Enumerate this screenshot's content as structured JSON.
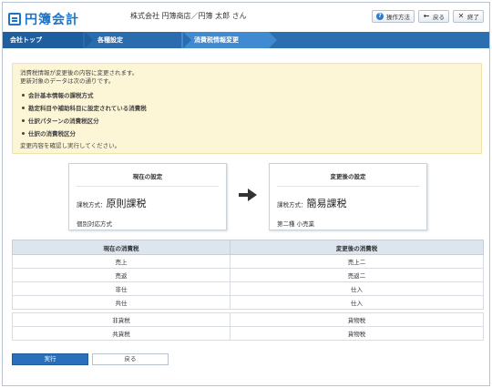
{
  "app": {
    "logo": "円簿会計",
    "company_user": "株式会社 円簿商店／円簿 太郎 さん"
  },
  "header_buttons": [
    {
      "label": "操作方法",
      "icon": "help-icon"
    },
    {
      "label": "戻る",
      "icon": "back-arrow-icon"
    },
    {
      "label": "終了",
      "icon": "close-icon"
    }
  ],
  "breadcrumb": [
    "会社トップ",
    "各種設定",
    "消費税情報変更"
  ],
  "notice": {
    "line1": "消費税情報が変更後の内容に変更されます。",
    "line2": "更新対象のデータは次の通りです。",
    "items": [
      "会計基本情報の課税方式",
      "勘定科目や補助科目に設定されている消費税",
      "仕訳パターンの消費税区分",
      "仕訳の消費税区分"
    ],
    "footer": "変更内容を確認し実行してください。"
  },
  "current": {
    "title": "現在の設定",
    "method_label": "課税方式：",
    "method_value": "原則課税",
    "sub": "個別対応方式"
  },
  "after": {
    "title": "変更後の設定",
    "method_label": "課税方式：",
    "method_value": "簡易課税",
    "sub": "第二種 小売業"
  },
  "table": {
    "headers": [
      "現在の消費税",
      "変更後の消費税"
    ],
    "group1": [
      [
        "売上",
        "売上二"
      ],
      [
        "売返",
        "売返二"
      ],
      [
        "非仕",
        "仕入"
      ],
      [
        "共仕",
        "仕入"
      ]
    ],
    "group2": [
      [
        "非貨税",
        "貨物税"
      ],
      [
        "共貨税",
        "貨物税"
      ]
    ]
  },
  "actions": {
    "run": "実行",
    "back": "戻る"
  },
  "colors": {
    "accent": "#2a6fba",
    "notice_bg": "#fdf6d6",
    "header_blue": "#1e74c6"
  }
}
